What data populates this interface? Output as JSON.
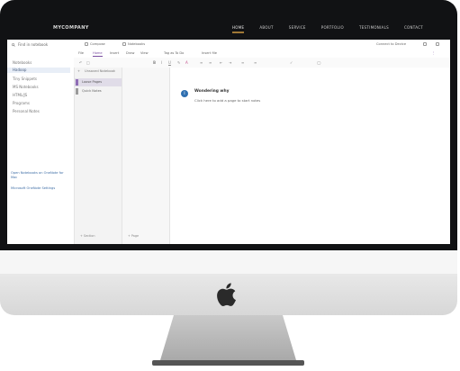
{
  "site": {
    "brand": "MYCOMPANY",
    "nav": [
      {
        "label": "HOME",
        "active": true
      },
      {
        "label": "ABOUT",
        "active": false
      },
      {
        "label": "SERVICE",
        "active": false
      },
      {
        "label": "PORTFOLIO",
        "active": false
      },
      {
        "label": "TESTIMONIALS",
        "active": false
      },
      {
        "label": "CONTACT",
        "active": false
      }
    ]
  },
  "app": {
    "search": {
      "label": "Find in notebook"
    },
    "toolbar": {
      "item1": "Compose",
      "item2": "Notebooks",
      "right": "Connect to Device"
    },
    "sidebar": {
      "items": [
        "Notebooks",
        "Hadoop",
        "Tiny Snippets",
        "MS Notebooks",
        "HTML/JS",
        "Programs",
        "Personal Notes"
      ],
      "active_index": 1,
      "links": [
        "Open Notebooks on OneNote for Mac",
        "Microsoft OneNote Settings"
      ]
    },
    "ribbon": {
      "tabs": [
        "File",
        "Home",
        "Insert",
        "Draw",
        "View"
      ],
      "active_tab": 1,
      "tools_label": "Tag as To Do",
      "tools_extra": "Insert file"
    },
    "sections": {
      "header": "Unsaved Notebook",
      "items": [
        {
          "label": "Loose Pages",
          "color": "#8f6db5",
          "active": true
        },
        {
          "label": "Quick Notes",
          "color": "#9b9b9b",
          "active": false
        }
      ],
      "footer": "+ Section"
    },
    "pages": {
      "footer": "+ Page"
    },
    "notice": {
      "icon": "info-icon",
      "title": "Wondering why",
      "text": "Click here to add a page to start notes"
    }
  },
  "colors": {
    "bezel": "#111214",
    "accent": "#a07836",
    "onenote_purple": "#7a4da0"
  }
}
